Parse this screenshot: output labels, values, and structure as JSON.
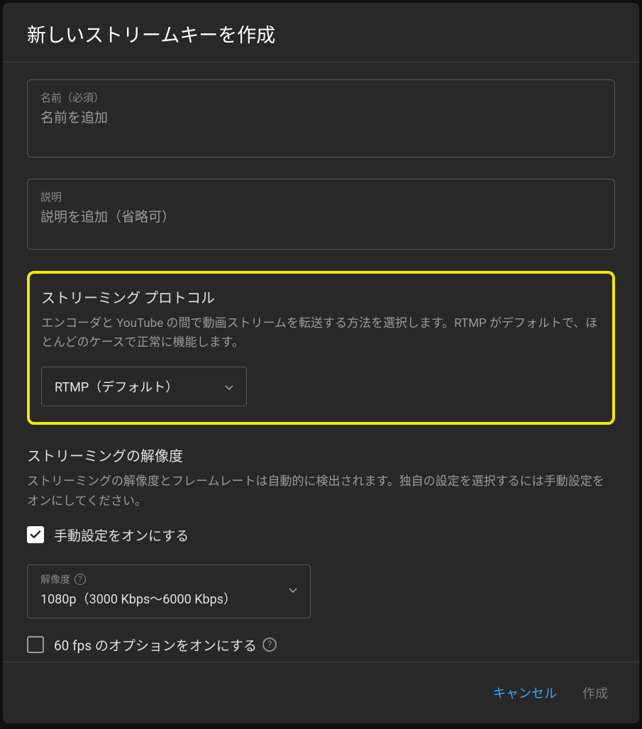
{
  "dialog": {
    "title": "新しいストリームキーを作成"
  },
  "name_field": {
    "label": "名前（必須）",
    "placeholder": "名前を追加",
    "value": ""
  },
  "description_field": {
    "label": "説明",
    "placeholder": "説明を追加（省略可）",
    "value": ""
  },
  "protocol_section": {
    "title": "ストリーミング プロトコル",
    "description": "エンコーダと YouTube の間で動画ストリームを転送する方法を選択します。RTMP がデフォルトで、ほとんどのケースで正常に機能します。",
    "selected": "RTMP（デフォルト）"
  },
  "resolution_section": {
    "title": "ストリーミングの解像度",
    "description": "ストリーミングの解像度とフレームレートは自動的に検出されます。独自の設定を選択するには手動設定をオンにしてください。",
    "manual_checkbox_label": "手動設定をオンにする",
    "manual_checked": true,
    "resolution_label": "解像度",
    "resolution_value": "1080p（3000 Kbps～6000 Kbps）",
    "sixtyfps_label": "60 fps のオプションをオンにする",
    "sixtyfps_checked": false
  },
  "footer": {
    "cancel": "キャンセル",
    "create": "作成"
  },
  "icons": {
    "help": "?"
  }
}
